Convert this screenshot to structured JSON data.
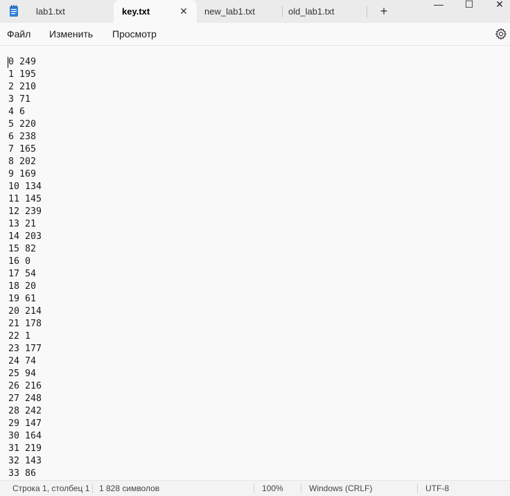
{
  "tabs": [
    {
      "label": "lab1.txt",
      "active": false
    },
    {
      "label": "key.txt",
      "active": true
    },
    {
      "label": "new_lab1.txt",
      "active": false
    },
    {
      "label": "old_lab1.txt",
      "active": false
    }
  ],
  "tab_close_symbol": "✕",
  "new_tab_symbol": "+",
  "window_controls": {
    "minimize": "—",
    "maximize": "☐",
    "close": "✕"
  },
  "menu": {
    "file": "Файл",
    "edit": "Изменить",
    "view": "Просмотр"
  },
  "icons": {
    "app": "notepad-icon",
    "settings": "gear-icon"
  },
  "editor": {
    "lines": [
      "0 249",
      "1 195",
      "2 210",
      "3 71",
      "4 6",
      "5 220",
      "6 238",
      "7 165",
      "8 202",
      "9 169",
      "10 134",
      "11 145",
      "12 239",
      "13 21",
      "14 203",
      "15 82",
      "16 0",
      "17 54",
      "18 20",
      "19 61",
      "20 214",
      "21 178",
      "22 1",
      "23 177",
      "24 74",
      "25 94",
      "26 216",
      "27 248",
      "28 242",
      "29 147",
      "30 164",
      "31 219",
      "32 143",
      "33 86"
    ]
  },
  "status": {
    "position": "Строка 1, столбец 1",
    "chars": "1 828 символов",
    "zoom": "100%",
    "line_ending": "Windows (CRLF)",
    "encoding": "UTF-8"
  },
  "colors": {
    "accent": "#1a73c8",
    "background": "#f9f9f9",
    "tabbar": "#ebebeb"
  }
}
